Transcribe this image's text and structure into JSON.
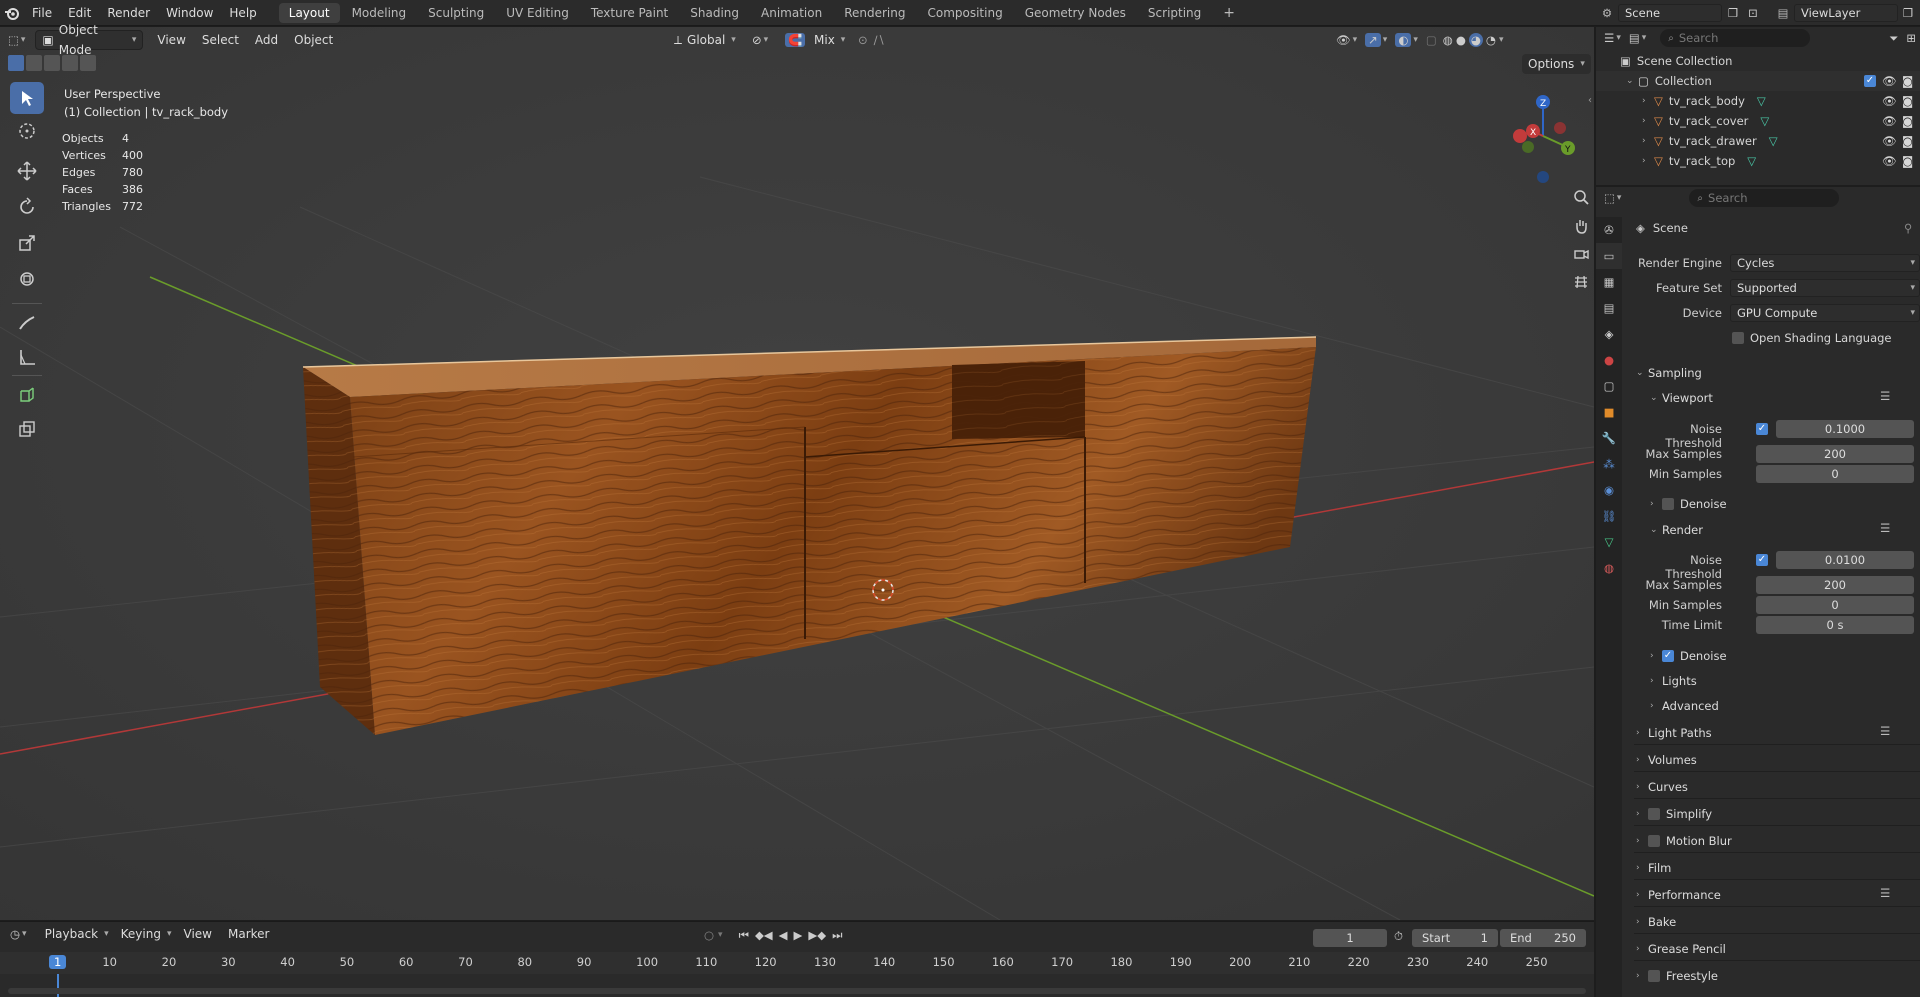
{
  "topbar": {
    "menus": [
      "File",
      "Edit",
      "Render",
      "Window",
      "Help"
    ],
    "workspaces": [
      "Layout",
      "Modeling",
      "Sculpting",
      "UV Editing",
      "Texture Paint",
      "Shading",
      "Animation",
      "Rendering",
      "Compositing",
      "Geometry Nodes",
      "Scripting"
    ],
    "active_workspace": "Layout",
    "scene_name": "Scene",
    "view_layer": "ViewLayer"
  },
  "viewport_header": {
    "mode": "Object Mode",
    "menus": [
      "View",
      "Select",
      "Add",
      "Object"
    ],
    "orientation": "Global",
    "snap": "Mix",
    "options": "Options"
  },
  "overlay": {
    "perspective": "User Perspective",
    "collection_line": "(1) Collection | tv_rack_body",
    "stats": [
      {
        "label": "Objects",
        "value": "4"
      },
      {
        "label": "Vertices",
        "value": "400"
      },
      {
        "label": "Edges",
        "value": "780"
      },
      {
        "label": "Faces",
        "value": "386"
      },
      {
        "label": "Triangles",
        "value": "772"
      }
    ]
  },
  "outliner": {
    "search_placeholder": "Search",
    "root": "Scene Collection",
    "collection": "Collection",
    "objects": [
      "tv_rack_body",
      "tv_rack_cover",
      "tv_rack_drawer",
      "tv_rack_top"
    ]
  },
  "properties": {
    "search_placeholder": "Search",
    "context": "Scene",
    "render_engine_label": "Render Engine",
    "render_engine": "Cycles",
    "feature_set_label": "Feature Set",
    "feature_set": "Supported",
    "device_label": "Device",
    "device": "GPU Compute",
    "osl_label": "Open Shading Language",
    "sampling": "Sampling",
    "viewport": "Viewport",
    "noise_threshold_label": "Noise Threshold",
    "viewport_noise_threshold": "0.1000",
    "max_samples_label": "Max Samples",
    "viewport_max_samples": "200",
    "min_samples_label": "Min Samples",
    "viewport_min_samples": "0",
    "denoise_label": "Denoise",
    "render": "Render",
    "render_noise_threshold": "0.0100",
    "render_max_samples": "200",
    "render_min_samples": "0",
    "time_limit_label": "Time Limit",
    "render_time_limit": "0 s",
    "lights": "Lights",
    "advanced": "Advanced",
    "panels": [
      "Light Paths",
      "Volumes",
      "Curves",
      "Simplify",
      "Motion Blur",
      "Film",
      "Performance",
      "Bake",
      "Grease Pencil",
      "Freestyle"
    ]
  },
  "timeline": {
    "menus": [
      "Playback",
      "Keying",
      "View",
      "Marker"
    ],
    "current_frame": "1",
    "start_label": "Start",
    "start": "1",
    "end_label": "End",
    "end": "250",
    "ticks": [
      "1",
      "10",
      "20",
      "30",
      "40",
      "50",
      "60",
      "70",
      "80",
      "90",
      "100",
      "110",
      "120",
      "130",
      "140",
      "150",
      "160",
      "170",
      "180",
      "190",
      "200",
      "210",
      "220",
      "230",
      "240",
      "250"
    ]
  },
  "colors": {
    "accent": "#4a87d6",
    "active_tool": "#4a6ea8",
    "wood": "#8a4a1c",
    "x_axis": "#c23b3b",
    "y_axis": "#6a9c2a",
    "z_axis": "#2f66c7"
  }
}
